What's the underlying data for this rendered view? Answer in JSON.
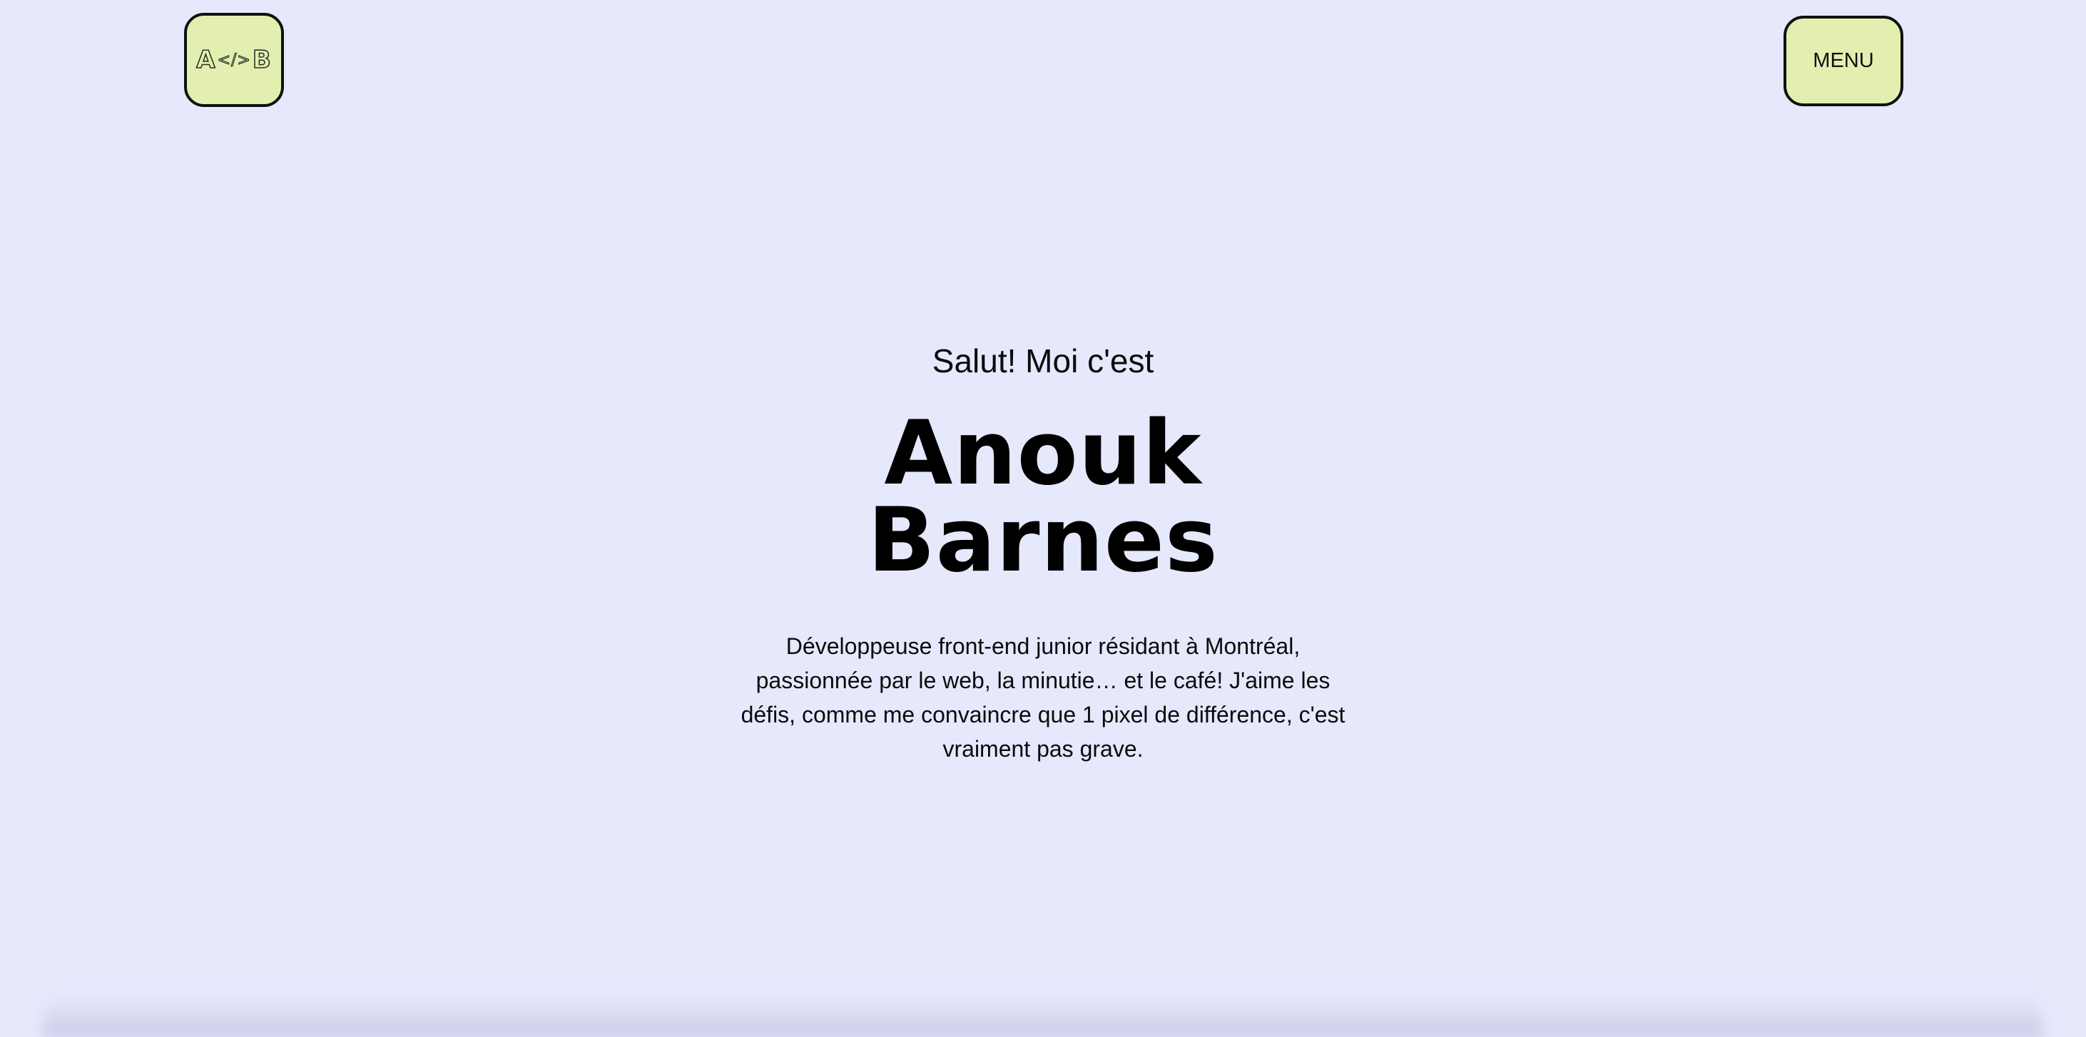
{
  "header": {
    "logo": {
      "left": "A",
      "separator": "</>",
      "right": "B",
      "icon": "logo-monogram-icon"
    },
    "menu_label": "MENU"
  },
  "hero": {
    "greeting": "Salut! Moi c'est",
    "first_name": "Anouk",
    "last_name": "Barnes",
    "bio": "Développeuse front-end junior résidant à Montréal, passionnée par le web, la minutie… et le café! J'aime les défis, comme me convaincre que 1 pixel de différence, c'est vraiment pas grave."
  },
  "colors": {
    "background": "#e6e8fc",
    "button_fill": "#e3efb0",
    "button_border": "#111111",
    "text": "#0b0b0b"
  }
}
